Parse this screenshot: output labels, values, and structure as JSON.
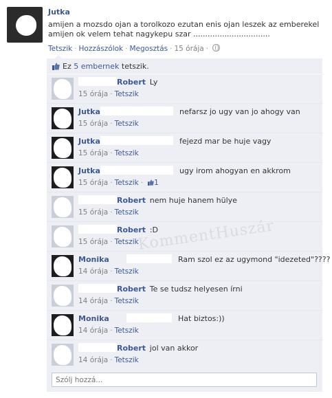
{
  "post": {
    "author": "Jutka",
    "text": "amijen a mozsdo ojan a torolkozo ezutan enis ojan leszek az emberekel amijen ok velem tehat nagykepu szar ................................",
    "actions": [
      "Tetszik",
      "Hozzászólok",
      "Megosztás"
    ],
    "time": "15 órája"
  },
  "likes": {
    "prefix": "Ez ",
    "link": "5 embernek",
    "suffix": " tetszik."
  },
  "comments": [
    {
      "author": "Robert",
      "text": "Ly",
      "time": "15 órája",
      "like": "Tetszik",
      "likes": ""
    },
    {
      "author": "Jutka",
      "text": "nefarsz jo ugy van jo ahogy van",
      "time": "15 órája",
      "like": "Tetszik",
      "likes": ""
    },
    {
      "author": "Jutka",
      "text": "fejezd mar be huje vagy",
      "time": "15 órája",
      "like": "Tetszik",
      "likes": ""
    },
    {
      "author": "Jutka",
      "text": "ugy irom ahogyan en akkrom",
      "time": "15 órája",
      "like": "Tetszik",
      "likes": "1"
    },
    {
      "author": "Robert",
      "text": "nem huje hanem hülye",
      "time": "15 órája",
      "like": "Tetszik",
      "likes": ""
    },
    {
      "author": "Robert",
      "text": ":D",
      "time": "15 órája",
      "like": "Tetszik",
      "likes": ""
    },
    {
      "author": "Monika",
      "text": "Ram szol ez az ugymond \"idezeted\"????",
      "time": "14 órája",
      "like": "Tetszik",
      "likes": ""
    },
    {
      "author": "Robert",
      "text": "Te se tudsz helyesen írni",
      "time": "14 órája",
      "like": "Tetszik",
      "likes": ""
    },
    {
      "author": "Monika",
      "text": "Hat biztos:))",
      "time": "14 órája",
      "like": "Tetszik",
      "likes": ""
    },
    {
      "author": "Robert",
      "text": "jol van akkor",
      "time": "14 órája",
      "like": "Tetszik",
      "likes": ""
    }
  ],
  "reply": {
    "placeholder": "Szólj hozzá..."
  },
  "watermark": "KommentHuszár",
  "colors": {
    "link": "#3b5998",
    "ufi_bg": "#edeff4",
    "meta": "#7f7f7f"
  }
}
